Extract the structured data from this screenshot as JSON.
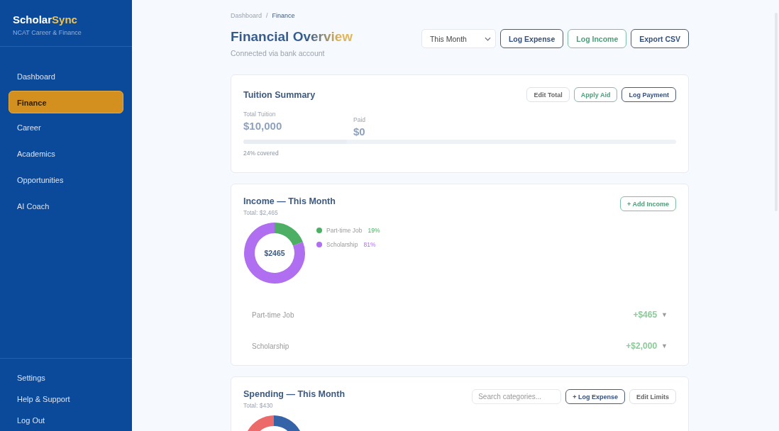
{
  "sidebar": {
    "brand": {
      "primary": "Scholar",
      "accent": "Sync"
    },
    "subtitle": "NCAT Career & Finance",
    "items": [
      {
        "label": "Dashboard",
        "selected": false
      },
      {
        "label": "Finance",
        "selected": true
      },
      {
        "label": "Career",
        "selected": false
      },
      {
        "label": "Academics",
        "selected": false
      },
      {
        "label": "Opportunities",
        "selected": false
      },
      {
        "label": "AI Coach",
        "selected": false
      }
    ],
    "footer_items": [
      "Settings",
      "Help & Support",
      "Log Out"
    ]
  },
  "breadcrumb": {
    "parent": "Dashboard",
    "separator": "/",
    "current": "Finance"
  },
  "header": {
    "title": "Financial Overview",
    "subtitle": "Connected via bank account",
    "period": "This Month",
    "buttons": [
      {
        "label": "Log Expense",
        "kind": "primary"
      },
      {
        "label": "Log Income",
        "kind": "success"
      },
      {
        "label": "Export CSV",
        "kind": "primary"
      }
    ]
  },
  "tuition": {
    "title": "Tuition Summary",
    "buttons": [
      {
        "label": "Edit Total",
        "kind": "muted"
      },
      {
        "label": "Apply Aid",
        "kind": "success"
      },
      {
        "label": "Log Payment",
        "kind": "primary"
      }
    ],
    "stats": [
      {
        "label": "Total Tuition",
        "value": "$10,000"
      },
      {
        "label": "Paid",
        "value": "$0"
      }
    ],
    "level": 0.24,
    "covered": "24% covered"
  },
  "income": {
    "title": "Income — This Month",
    "total": "Total: $2,465",
    "button": "+ Add Income",
    "center": "$2465",
    "chart_data": {
      "type": "donut",
      "categories": [
        "Part-time Job",
        "Scholarship"
      ],
      "values": [
        19,
        81
      ]
    },
    "legend": [
      {
        "percent": "19%",
        "color": "#4caf63"
      },
      {
        "percent": "81%",
        "color": "#b06ef0"
      }
    ],
    "rows": [
      {
        "label": "Part-time Job",
        "amount": "+$465",
        "toggle": "▼"
      },
      {
        "label": "Scholarship",
        "amount": "+$2,000",
        "toggle": "▼"
      }
    ]
  },
  "spending": {
    "title": "Spending — This Month",
    "total": "Total: $430",
    "search_placeholder": "Search categories...",
    "buttons": [
      {
        "label": "+ Log Expense",
        "kind": "primary"
      },
      {
        "label": "Edit Limits",
        "kind": "muted"
      }
    ]
  }
}
